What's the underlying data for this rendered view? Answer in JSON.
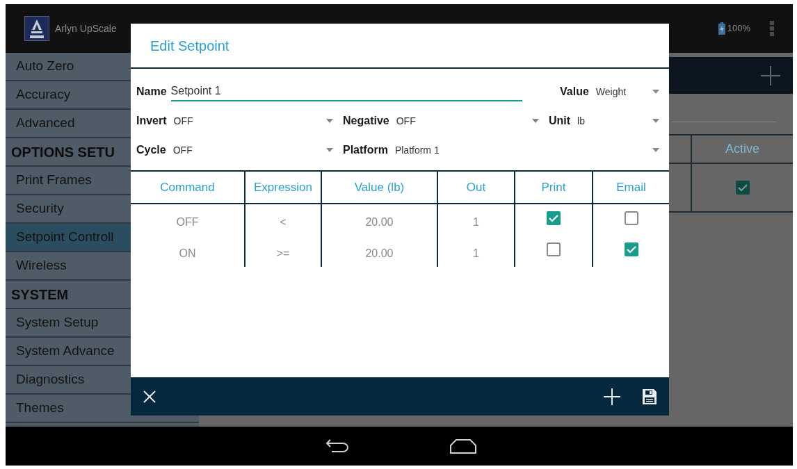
{
  "app": {
    "title": "Arlyn UpScale",
    "battery": "100%"
  },
  "sidebar": {
    "items": [
      {
        "label": "Auto Zero",
        "kind": "item",
        "selected": false
      },
      {
        "label": "Accuracy",
        "kind": "item",
        "selected": false
      },
      {
        "label": "Advanced",
        "kind": "item",
        "selected": false
      },
      {
        "label": "OPTIONS SETU",
        "kind": "header"
      },
      {
        "label": "Print Frames",
        "kind": "item",
        "selected": false
      },
      {
        "label": "Security",
        "kind": "item",
        "selected": false
      },
      {
        "label": "Setpoint Controll",
        "kind": "item",
        "selected": true
      },
      {
        "label": "Wireless",
        "kind": "item",
        "selected": false
      },
      {
        "label": "SYSTEM",
        "kind": "header"
      },
      {
        "label": "System Setup",
        "kind": "item",
        "selected": false
      },
      {
        "label": "System Advance",
        "kind": "item",
        "selected": false
      },
      {
        "label": "Diagnostics",
        "kind": "item",
        "selected": false
      },
      {
        "label": "Themes",
        "kind": "item",
        "selected": false
      }
    ]
  },
  "background_table": {
    "column_header": "Active",
    "rows": [
      {
        "active": true
      }
    ]
  },
  "dialog": {
    "title": "Edit Setpoint",
    "form_rows": [
      [
        {
          "label": "Name",
          "value": "Setpoint 1",
          "kind": "text"
        },
        {
          "label": "Value",
          "value": "Weight",
          "kind": "dropdown"
        }
      ],
      [
        {
          "label": "Invert",
          "value": "OFF",
          "kind": "dropdown"
        },
        {
          "label": "Negative",
          "value": "OFF",
          "kind": "dropdown"
        },
        {
          "label": "Unit",
          "value": "lb",
          "kind": "dropdown"
        }
      ],
      [
        {
          "label": "Cycle",
          "value": "OFF",
          "kind": "dropdown"
        },
        {
          "label": "Platform",
          "value": "Platform 1",
          "kind": "dropdown"
        }
      ]
    ],
    "table": {
      "columns": [
        "Command",
        "Expression",
        "Value (lb)",
        "Out",
        "Print",
        "Email"
      ],
      "rows": [
        {
          "command": "OFF",
          "expression": "<",
          "value": "20.00",
          "out": "1",
          "print": true,
          "email": false
        },
        {
          "command": "ON",
          "expression": ">=",
          "value": "20.00",
          "out": "1",
          "print": false,
          "email": true
        }
      ]
    }
  }
}
